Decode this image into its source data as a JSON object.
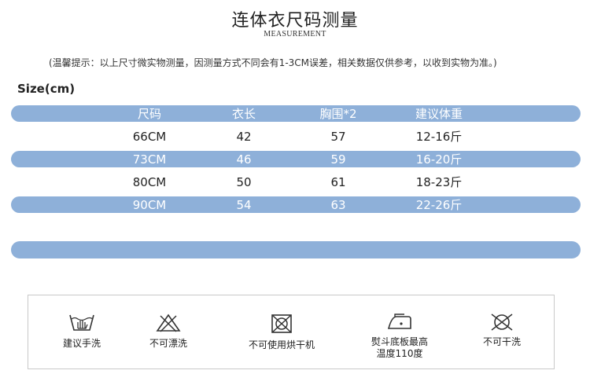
{
  "header": {
    "title": "连体衣尺码测量",
    "subtitle": "MEASUREMENT",
    "note": "(温馨提示：以上尺寸微实物测量，因测量方式不同会有1-3CM误差，相关数据仅供参考，以收到实物为准。)"
  },
  "size_table": {
    "label": "Size(cm)",
    "columns": [
      "尺码",
      "衣长",
      "胸围*2",
      "建议体重"
    ],
    "rows": [
      [
        "66CM",
        "42",
        "57",
        "12-16斤"
      ],
      [
        "73CM",
        "46",
        "59",
        "16-20斤"
      ],
      [
        "80CM",
        "50",
        "61",
        "18-23斤"
      ],
      [
        "90CM",
        "54",
        "63",
        "22-26斤"
      ]
    ]
  },
  "care": {
    "items": [
      {
        "icon": "hand-wash-icon",
        "label": "建议手洗"
      },
      {
        "icon": "no-bleach-icon",
        "label": "不可漂洗"
      },
      {
        "icon": "no-tumble-dry-icon",
        "label": "不可使用烘干机"
      },
      {
        "icon": "iron-110-icon",
        "label": "熨斗底板最高",
        "label2": "温度110度"
      },
      {
        "icon": "no-dry-clean-icon",
        "label": "不可干洗"
      }
    ]
  },
  "colors": {
    "band": "#8eb0d9",
    "border": "#c9c9c9"
  }
}
